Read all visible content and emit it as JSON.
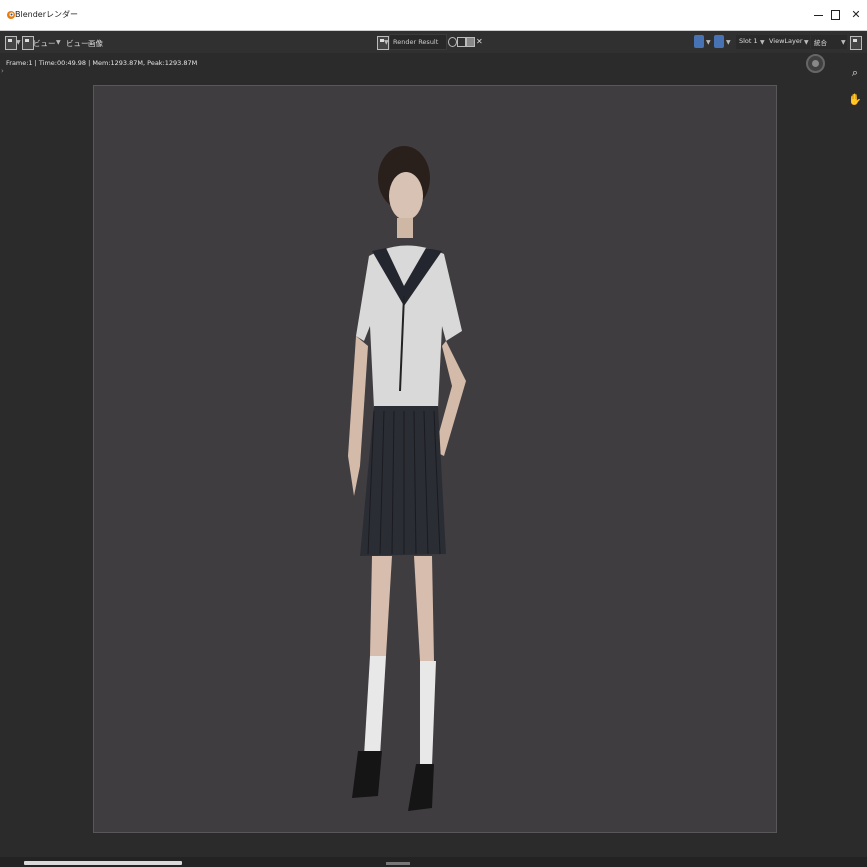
{
  "window": {
    "title": "Blenderレンダー"
  },
  "header": {
    "view_menu_1": "ビュー",
    "view_menu_2": "ビュー",
    "image_menu": "画像",
    "image_name": "Render Result",
    "slot": "Slot 1",
    "view_layer": "ViewLayer",
    "render_pass": "統合"
  },
  "info": {
    "stats": "Frame:1 | Time:00:49.98 | Mem:1293.87M, Peak:1293.87M"
  },
  "colors": {
    "accent": "#4772b3",
    "canvas_bg": "#403d41",
    "app_bg": "#2b2b2b"
  }
}
